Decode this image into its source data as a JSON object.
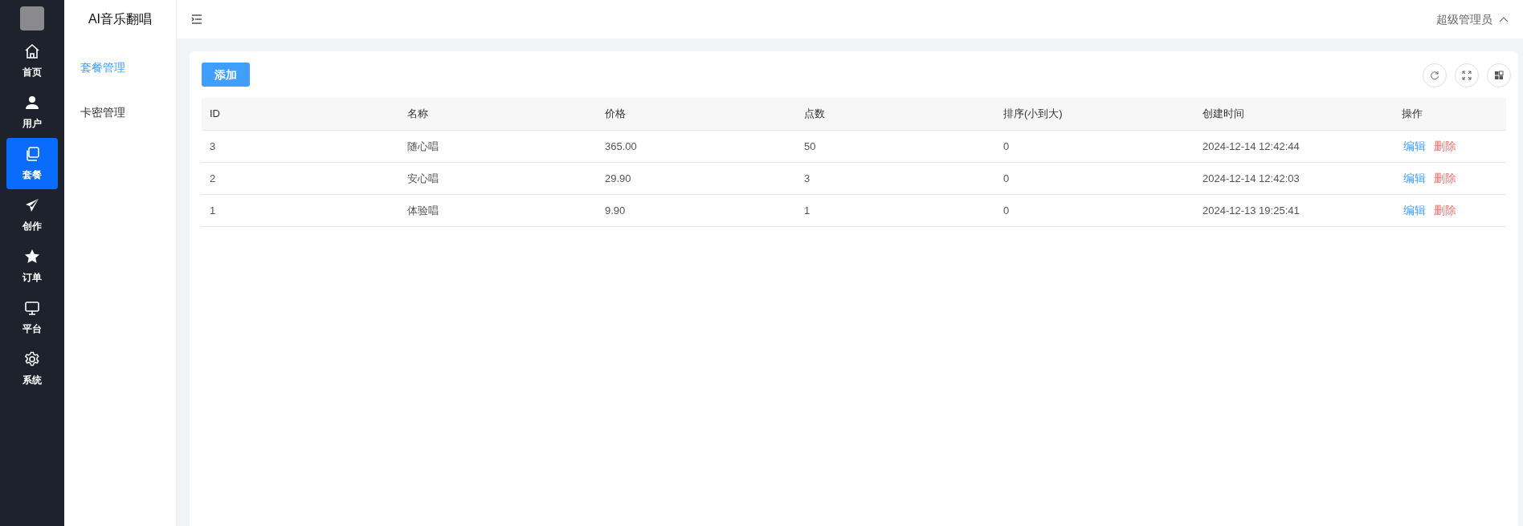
{
  "nav": [
    {
      "label": "首页",
      "kind": "home",
      "selected": false
    },
    {
      "label": "用户",
      "kind": "user",
      "selected": false
    },
    {
      "label": "套餐",
      "kind": "copy",
      "selected": true
    },
    {
      "label": "创作",
      "kind": "send",
      "selected": false
    },
    {
      "label": "订单",
      "kind": "star",
      "selected": false
    },
    {
      "label": "平台",
      "kind": "monitor",
      "selected": false
    },
    {
      "label": "系统",
      "kind": "gear",
      "selected": false
    }
  ],
  "app_title": "AI音乐翻唱",
  "submenu": [
    {
      "label": "套餐管理",
      "selected": true
    },
    {
      "label": "卡密管理",
      "selected": false
    }
  ],
  "user": "超级管理员",
  "add_button": "添加",
  "table": {
    "columns": [
      "ID",
      "名称",
      "价格",
      "点数",
      "排序(小到大)",
      "创建时间",
      "操作"
    ],
    "rows": [
      {
        "cells": [
          "3",
          "随心唱",
          "365.00",
          "50",
          "0",
          "2024-12-14 12:42:44"
        ],
        "actions": [
          "编辑",
          "删除"
        ]
      },
      {
        "cells": [
          "2",
          "安心唱",
          "29.90",
          "3",
          "0",
          "2024-12-14 12:42:03"
        ],
        "actions": [
          "编辑",
          "删除"
        ]
      },
      {
        "cells": [
          "1",
          "体验唱",
          "9.90",
          "1",
          "0",
          "2024-12-13 19:25:41"
        ],
        "actions": [
          "编辑",
          "删除"
        ]
      }
    ]
  }
}
